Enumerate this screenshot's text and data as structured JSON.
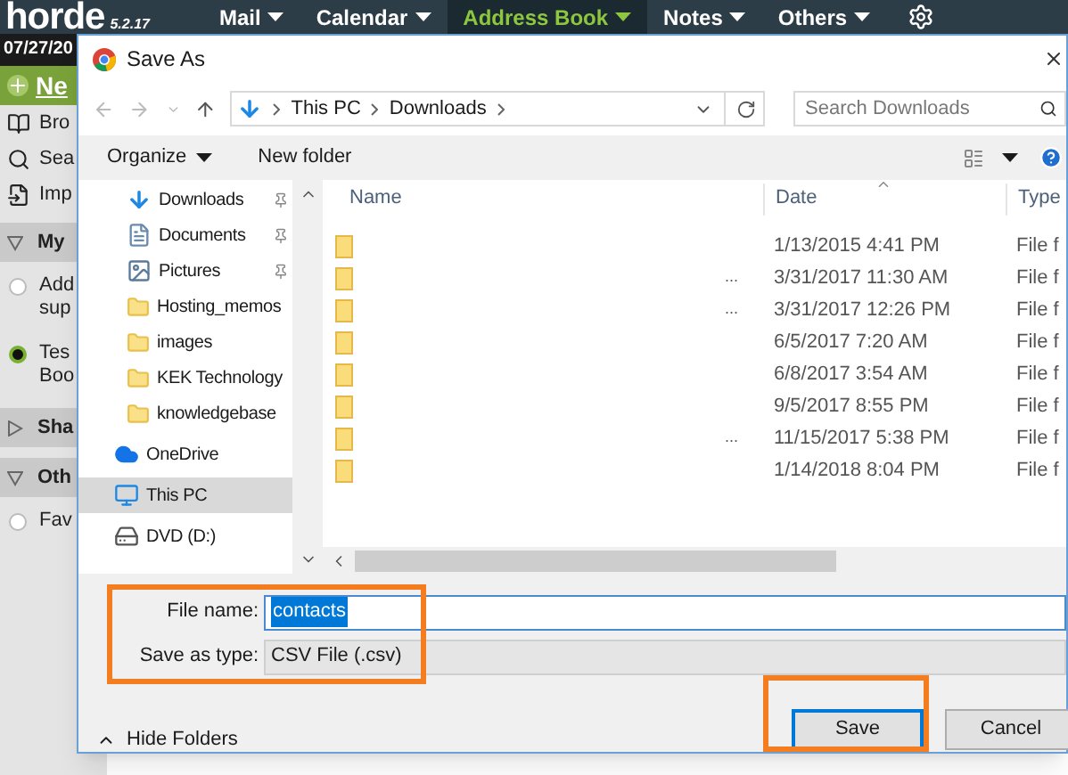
{
  "app": {
    "logo": "horde",
    "version": "5.2.17",
    "menu": [
      {
        "label": "Mail",
        "selected": false
      },
      {
        "label": "Calendar",
        "selected": false
      },
      {
        "label": "Address Book",
        "selected": true
      },
      {
        "label": "Notes",
        "selected": false
      },
      {
        "label": "Others",
        "selected": false
      }
    ],
    "sidebar": {
      "date": "07/27/20",
      "new_button": "Ne",
      "actions": [
        {
          "kind": "book",
          "label": "Bro"
        },
        {
          "kind": "search",
          "label": "Sea"
        },
        {
          "kind": "import",
          "label": "Imp"
        }
      ],
      "sections": [
        {
          "title": "My",
          "expanded": true,
          "items": [
            {
              "lines": [
                "Add",
                "sup"
              ],
              "selected": false
            },
            {
              "lines": [
                "Tes",
                "Boo"
              ],
              "selected": true
            }
          ]
        },
        {
          "title": "Sha",
          "expanded": false
        },
        {
          "title": "Oth",
          "expanded": true,
          "items": [
            {
              "lines": [
                "Fav"
              ],
              "selected": false
            }
          ]
        }
      ]
    }
  },
  "dialog": {
    "title": "Save As",
    "breadcrumb": [
      "This PC",
      "Downloads"
    ],
    "search": {
      "placeholder": "Search Downloads"
    },
    "toolbar": {
      "organize": "Organize",
      "new_folder": "New folder"
    },
    "nav": [
      {
        "kind": "download",
        "label": "Downloads",
        "pinned": true,
        "selected": false
      },
      {
        "kind": "document",
        "label": "Documents",
        "pinned": true,
        "selected": false
      },
      {
        "kind": "picture",
        "label": "Pictures",
        "pinned": true,
        "selected": false
      },
      {
        "kind": "folder",
        "label": "Hosting_memos",
        "pinned": false,
        "selected": false
      },
      {
        "kind": "folder",
        "label": "images",
        "pinned": false,
        "selected": false
      },
      {
        "kind": "folder",
        "label": "KEK Technology",
        "pinned": false,
        "selected": false
      },
      {
        "kind": "folder",
        "label": "knowledgebase",
        "pinned": false,
        "selected": false
      },
      {
        "kind": "cloud",
        "label": "OneDrive",
        "pinned": false,
        "selected": false
      },
      {
        "kind": "pc",
        "label": "This PC",
        "pinned": false,
        "selected": true
      },
      {
        "kind": "drive",
        "label": "DVD (D:)",
        "pinned": false,
        "selected": false
      }
    ],
    "columns": [
      "Name",
      "Date",
      "Type"
    ],
    "rows": [
      {
        "date": "1/13/2015 4:41 PM",
        "type": "File f"
      },
      {
        "name": "...",
        "date": "3/31/2017 11:30 AM",
        "type": "File f"
      },
      {
        "name": "...",
        "date": "3/31/2017 12:26 PM",
        "type": "File f"
      },
      {
        "date": "6/5/2017 7:20 AM",
        "type": "File f"
      },
      {
        "date": "6/8/2017 3:54 AM",
        "type": "File f"
      },
      {
        "date": "9/5/2017 8:55 PM",
        "type": "File f"
      },
      {
        "name": "...",
        "date": "11/15/2017 5:38 PM",
        "type": "File f"
      },
      {
        "date": "1/14/2018 8:04 PM",
        "type": "File f"
      }
    ],
    "file_name": {
      "label": "File name:",
      "value": "contacts",
      "text_selected": true
    },
    "save_as_type": {
      "label": "Save as type:",
      "value": "CSV File (.csv)"
    },
    "hide_folders": "Hide Folders",
    "buttons": [
      {
        "label": "Save",
        "kind": "primary"
      },
      {
        "label": "Cancel",
        "kind": "normal"
      }
    ]
  }
}
